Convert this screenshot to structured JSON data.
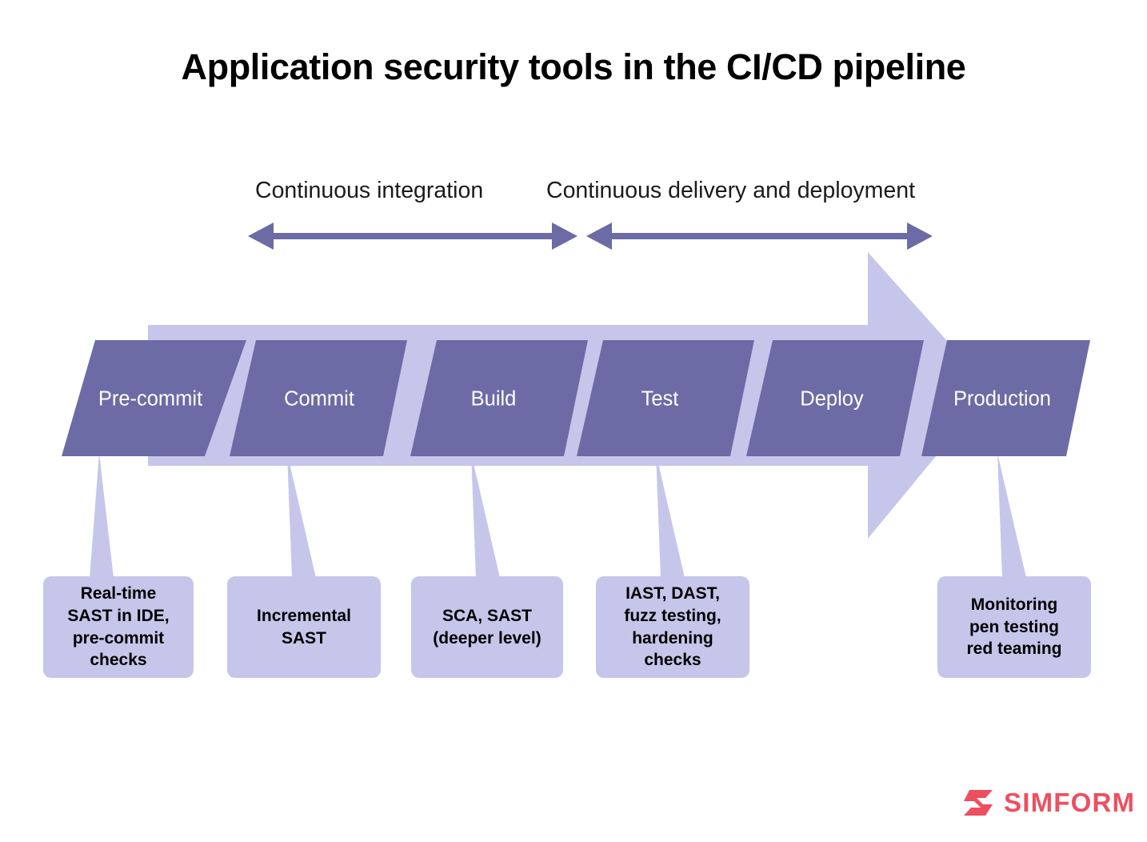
{
  "title": "Application security tools in the CI/CD pipeline",
  "colors": {
    "stage_fill": "#6c6ba6",
    "arrow_fill": "#c5c6ea",
    "callout_fill": "#c5c6ea",
    "phase_arrow": "#6c6ba6",
    "title_text": "#000000",
    "stage_text": "#ffffff",
    "callout_text": "#000000",
    "logo_red": "#ee4f5f",
    "background": "#ffffff"
  },
  "phases": [
    {
      "id": "ci",
      "label": "Continuous integration",
      "arrow": "double-headed-arrow"
    },
    {
      "id": "cd",
      "label": "Continuous delivery and deployment",
      "arrow": "double-headed-arrow"
    }
  ],
  "pipeline": {
    "shape": "block-arrow-right",
    "stages": [
      {
        "id": "pre-commit",
        "label": "Pre-commit"
      },
      {
        "id": "commit",
        "label": "Commit"
      },
      {
        "id": "build",
        "label": "Build"
      },
      {
        "id": "test",
        "label": "Test"
      },
      {
        "id": "deploy",
        "label": "Deploy"
      },
      {
        "id": "production",
        "label": "Production"
      }
    ]
  },
  "callouts": [
    {
      "stage": "pre-commit",
      "text": "Real-time\nSAST in IDE,\npre-commit\nchecks"
    },
    {
      "stage": "commit",
      "text": "Incremental\nSAST"
    },
    {
      "stage": "build",
      "text": "SCA, SAST\n(deeper level)"
    },
    {
      "stage": "test",
      "text": "IAST, DAST,\nfuzz testing,\nhardening\nchecks"
    },
    {
      "stage": "production",
      "text": "Monitoring\npen testing\nred teaming"
    }
  ],
  "logo": {
    "wordmark": "SIMFORM",
    "icon": "simform-s-mark-icon"
  }
}
